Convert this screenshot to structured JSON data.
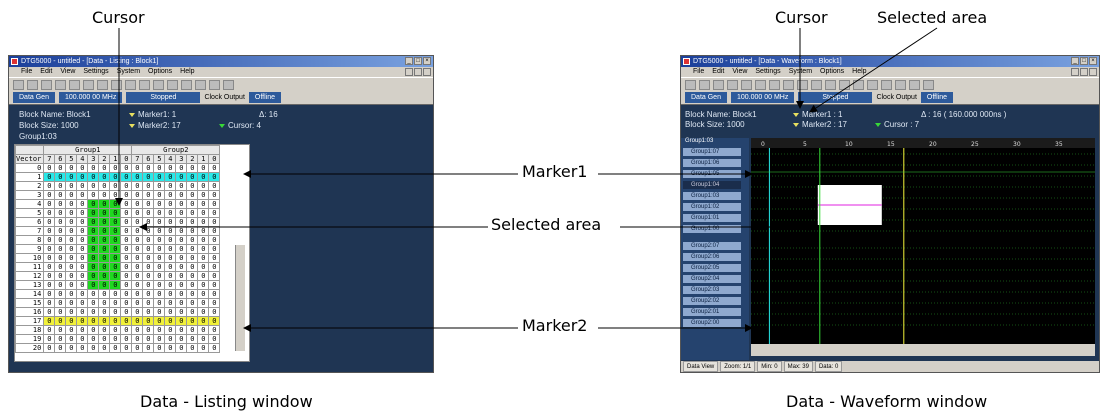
{
  "callouts": {
    "cursor_left": "Cursor",
    "cursor_right": "Cursor",
    "selected_top": "Selected area",
    "marker1": "Marker1",
    "selected_mid": "Selected area",
    "marker2": "Marker2"
  },
  "captions": {
    "listing": "Data - Listing window",
    "waveform": "Data - Waveform window"
  },
  "listing": {
    "title": "DTG5000 - untitled - [Data - Listing : Block1]",
    "menu": [
      "File",
      "Edit",
      "View",
      "Settings",
      "System",
      "Options",
      "Help"
    ],
    "status": {
      "mode": "Data Gen",
      "rate": "100.000 00 MHz",
      "state": "Stopped",
      "clock": "Clock Output",
      "offline": "Offline"
    },
    "info": {
      "block_name": "Block Name: Block1",
      "block_size": "Block Size: 1000",
      "group": "Group1:03",
      "marker1": "Marker1: 1",
      "marker2": "Marker2: 17",
      "delta": "Δ: 16",
      "cursor": "Cursor: 4"
    },
    "group_headers": [
      "Group1",
      "Group2"
    ],
    "vector_label": "Vector",
    "bits": [
      "7",
      "6",
      "5",
      "4",
      "3",
      "2",
      "1",
      "0",
      "7",
      "6",
      "5",
      "4",
      "3",
      "2",
      "1",
      "0"
    ],
    "rows": [
      "0",
      "1",
      "2",
      "3",
      "4",
      "5",
      "6",
      "7",
      "8",
      "9",
      "10",
      "11",
      "12",
      "13",
      "14",
      "15",
      "16",
      "17",
      "18",
      "19",
      "20"
    ]
  },
  "waveform": {
    "title": "DTG5000 - untitled - [Data - Waveform : Block1]",
    "menu": [
      "File",
      "Edit",
      "View",
      "Settings",
      "System",
      "Options",
      "Help"
    ],
    "status": {
      "mode": "Data Gen",
      "rate": "100.000 00 MHz",
      "state": "Stopped",
      "clock": "Clock Output",
      "offline": "Offline"
    },
    "info": {
      "block_name": "Block Name: Block1",
      "block_size": "Block Size: 1000",
      "marker1": "Marker1 : 1",
      "marker2": "Marker2 : 17",
      "delta": "Δ : 16  ( 160.000 000ns )",
      "cursor": "Cursor : 7"
    },
    "axis_header": "Group1:03",
    "ticks": [
      "0",
      "5",
      "10",
      "15",
      "20",
      "25",
      "30",
      "35"
    ],
    "groups": [
      "Group1:07",
      "Group1:06",
      "Group1:05",
      "Group1:04",
      "Group1:03",
      "Group1:02",
      "Group1:01",
      "Group1:00",
      "Group2:07",
      "Group2:06",
      "Group2:05",
      "Group2:04",
      "Group2:03",
      "Group2:02",
      "Group2:01",
      "Group2:00"
    ],
    "bottom": {
      "view": "Data View",
      "zoom": "Zoom: 1/1",
      "min": "Min: 0",
      "max": "Max: 39",
      "data": "Data: 0"
    }
  },
  "colors": {
    "panel": "#1f3553",
    "marker1": "#29e8e8",
    "marker2": "#f1f13a",
    "selected": "#20d820"
  }
}
